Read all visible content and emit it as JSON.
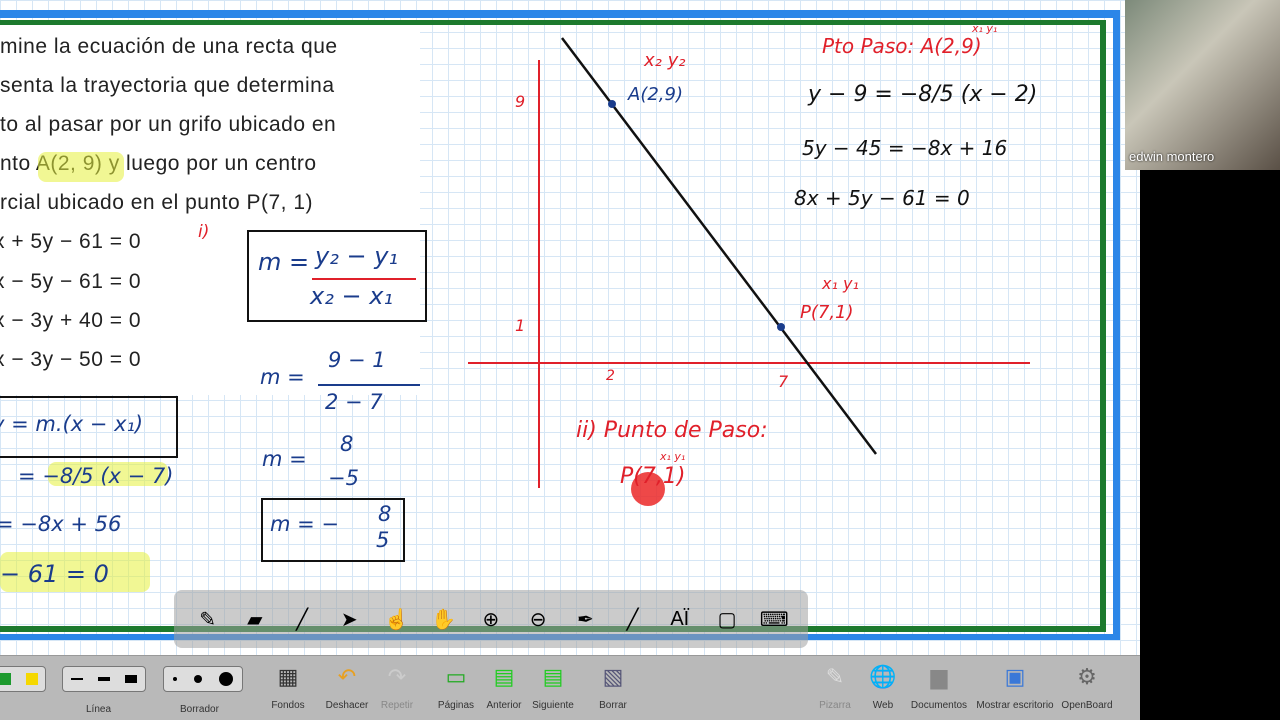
{
  "problem": {
    "lines": [
      "mine la ecuación de una recta que",
      "senta la trayectoria que determina",
      "to al pasar por un grifo ubicado en",
      "nto A(2, 9) y luego por un centro",
      "rcial ubicado en el punto P(7, 1)"
    ],
    "options": [
      "x + 5y − 61 = 0",
      "x − 5y − 61 = 0",
      "x − 3y + 40 = 0",
      "x − 3y − 50 = 0"
    ]
  },
  "handwriting": {
    "step_i": "i)",
    "slope_formula_num": "y₂ − y₁",
    "slope_formula_den": "x₂ − x₁",
    "m_eq": "m =",
    "m_sub_num": "9 − 1",
    "m_sub_den": "2 − 7",
    "m_val_num": "8",
    "m_val_den": "−5",
    "m_final": "m = −",
    "m_final_num": "8",
    "m_final_den": "5",
    "point_slope": "y = m.(x − x₁)",
    "ps_sub": "= −8/5 (x − 7)",
    "ps_exp": "= −8x + 56",
    "ps_final": "− 61 = 0",
    "x2y2": "x₂ y₂",
    "x1y1": "x₁ y₁",
    "pointA": "A(2,9)",
    "pointP": "P(7,1)",
    "tick9": "9",
    "tick1": "1",
    "tick2": "2",
    "tick7": "7",
    "step_ii": "ii) Punto de Paso:",
    "ii_point": "P(7,1)",
    "ii_sub": "x₁ y₁",
    "pto_paso": "Pto Paso: A(2,9)",
    "pto_sub": "x₁ y₁",
    "eq1": "y − 9 = −8/5 (x − 2)",
    "eq2": "5y − 45 = −8x + 16",
    "eq3": "8x + 5y − 61 = 0"
  },
  "webcam": {
    "name": "edwin montero"
  },
  "floating_toolbar": [
    {
      "icon": "pen-icon",
      "g": "✎"
    },
    {
      "icon": "eraser-icon",
      "g": "▰"
    },
    {
      "icon": "highlighter-icon",
      "g": "╱"
    },
    {
      "icon": "pointer-icon",
      "g": "➤"
    },
    {
      "icon": "laser-icon",
      "g": "☝"
    },
    {
      "icon": "hand-icon",
      "g": "✋"
    },
    {
      "icon": "zoom-in-icon",
      "g": "⊕"
    },
    {
      "icon": "zoom-out-icon",
      "g": "⊖"
    },
    {
      "icon": "pen-tool-icon",
      "g": "✒"
    },
    {
      "icon": "line-icon",
      "g": "╱"
    },
    {
      "icon": "text-icon",
      "g": "AÏ"
    },
    {
      "icon": "capture-icon",
      "g": "▢"
    },
    {
      "icon": "keyboard-icon",
      "g": "⌨"
    }
  ],
  "bottom_toolbar": {
    "linea": "Línea",
    "borrador": "Borrador",
    "fondos": "Fondos",
    "deshacer": "Deshacer",
    "repetir": "Repetir",
    "paginas": "Páginas",
    "anterior": "Anterior",
    "siguiente": "Siguiente",
    "borrar": "Borrar",
    "pizarra": "Pizarra",
    "web": "Web",
    "documentos": "Documentos",
    "escritorio": "Mostrar escritorio",
    "openboard": "OpenBoard"
  },
  "colors": {
    "frame_blue": "#2b86e8",
    "frame_green": "#1d7a2e",
    "ink_blue": "#1a3c8c",
    "ink_red": "#e0202a"
  }
}
